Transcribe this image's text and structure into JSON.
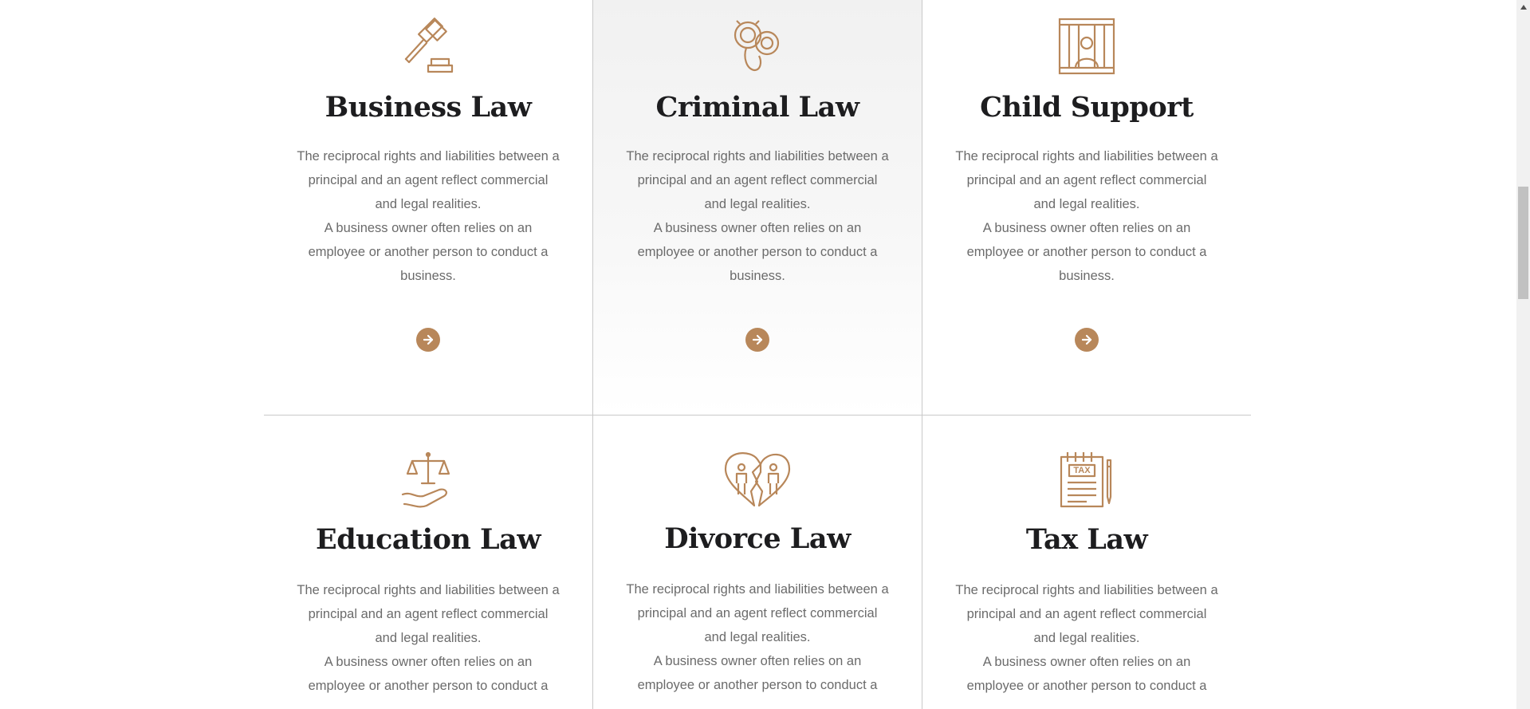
{
  "accent_color": "#b8875a",
  "services": [
    {
      "title": "Business Law",
      "icon": "gavel-icon",
      "desc": "The reciprocal rights and liabilities between a principal and an agent reflect commercial and legal realities.\nA business owner often relies on an employee or another person to conduct a business.",
      "arrow": "arrow-right-icon"
    },
    {
      "title": "Criminal Law",
      "icon": "handcuffs-icon",
      "desc": "The reciprocal rights and liabilities between a principal and an agent reflect commercial and legal realities.\nA business owner often relies on an employee or another person to conduct a business.",
      "arrow": "arrow-right-icon"
    },
    {
      "title": "Child Support",
      "icon": "prison-bars-icon",
      "desc": "The reciprocal rights and liabilities between a principal and an agent reflect commercial and legal realities.\nA business owner often relies on an employee or another person to conduct a business.",
      "arrow": "arrow-right-icon"
    },
    {
      "title": "Education Law",
      "icon": "scales-hand-icon",
      "desc": "The reciprocal rights and liabilities between a principal and an agent reflect commercial and legal realities.\nA business owner often relies on an employee or another person to conduct a",
      "arrow": "arrow-right-icon"
    },
    {
      "title": "Divorce Law",
      "icon": "broken-heart-icon",
      "desc": "The reciprocal rights and liabilities between a principal and an agent reflect commercial and legal realities.\nA business owner often relies on an employee or another person to conduct a",
      "arrow": "arrow-right-icon"
    },
    {
      "title": "Tax Law",
      "icon": "tax-document-icon",
      "desc": "The reciprocal rights and liabilities between a principal and an agent reflect commercial and legal realities.\nA business owner often relies on an employee or another person to conduct a",
      "arrow": "arrow-right-icon"
    }
  ],
  "tax_label": "TAX"
}
